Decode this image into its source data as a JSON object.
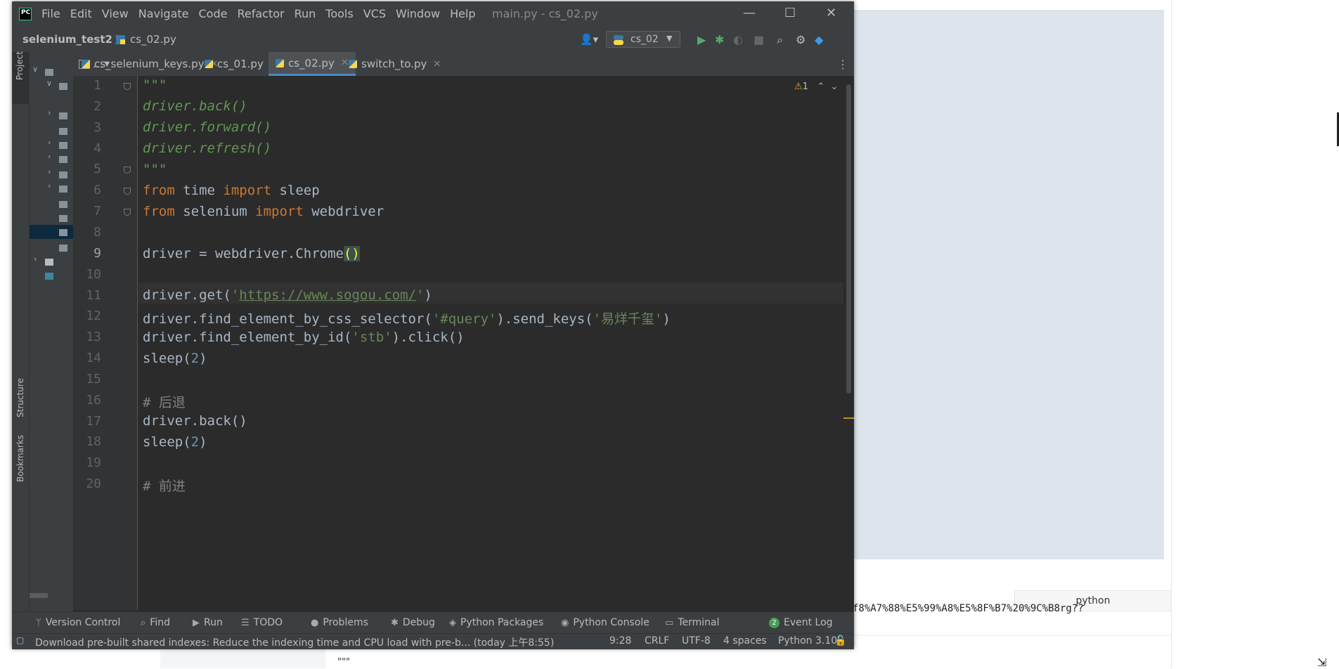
{
  "window": {
    "menu": [
      "File",
      "Edit",
      "View",
      "Navigate",
      "Code",
      "Refactor",
      "Run",
      "Tools",
      "VCS",
      "Window",
      "Help"
    ],
    "title": "main.py - cs_02.py",
    "controls": [
      "—",
      "☐",
      "✕"
    ]
  },
  "navbar": {
    "project": "selenium_test2",
    "file": "cs_02.py",
    "run_config": "cs_02"
  },
  "side_tabs": {
    "project": "Project",
    "structure": "Structure",
    "bookmarks": "Bookmarks"
  },
  "tabs": [
    {
      "label": "cs_selenium_keys.py",
      "active": false
    },
    {
      "label": "cs_01.py",
      "active": false
    },
    {
      "label": "cs_02.py",
      "active": true
    },
    {
      "label": "switch_to.py",
      "active": false
    }
  ],
  "tabs_more": "...",
  "editor": {
    "warnings": "1",
    "current_line": 9,
    "line_numbers": [
      "1",
      "2",
      "3",
      "4",
      "5",
      "6",
      "7",
      "8",
      "9",
      "10",
      "11",
      "12",
      "13",
      "14",
      "15",
      "16",
      "17",
      "18",
      "19",
      "20"
    ]
  },
  "code": {
    "l1": "\"\"\"",
    "l2": "driver.back()",
    "l3": "driver.forward()",
    "l4": "driver.refresh()",
    "l5": "\"\"\"",
    "l6_kw1": "from",
    "l6_mod": " time ",
    "l6_kw2": "import",
    "l6_name": " sleep",
    "l7_kw1": "from",
    "l7_mod": " selenium ",
    "l7_kw2": "import",
    "l7_name": " webdriver",
    "l9_pre": "driver = webdriver.Chrome",
    "l9_paren": "()",
    "l11_pre": "driver.get(",
    "l11_q1": "'",
    "l11_url": "https://www.sogou.com/",
    "l11_q2": "'",
    "l11_post": ")",
    "l12_pre": "driver.find_element_by_css_selector(",
    "l12_s1": "'#query'",
    "l12_mid": ").send_keys(",
    "l12_s2": "'易烊千玺'",
    "l12_post": ")",
    "l13_pre": "driver.find_element_by_id(",
    "l13_s": "'stb'",
    "l13_post": ").click()",
    "l14_pre": "sleep(",
    "l14_num": "2",
    "l14_post": ")",
    "l16": "# 后退",
    "l17": "driver.back()",
    "l18_pre": "sleep(",
    "l18_num": "2",
    "l18_post": ")",
    "l20": "# 前进"
  },
  "tool_windows": [
    "Version Control",
    "Find",
    "Run",
    "TODO",
    "Problems",
    "Debug",
    "Python Packages",
    "Python Console",
    "Terminal"
  ],
  "event_log": {
    "count": "2",
    "label": "Event Log"
  },
  "status": {
    "message": "Download pre-built shared indexes: Reduce the indexing time and CPU load with pre-b... (today 上午8:55)",
    "position": "9:28",
    "line_sep": "CRLF",
    "encoding": "UTF-8",
    "indent": "4 spaces",
    "interpreter": "Python 3.10"
  },
  "background": {
    "url_fragment": "f8%A7%88%E5%99%A8%E5%8F%B7%20%9C%B8rg??",
    "code_lang_tag": "python",
    "quotes": "\"\"\""
  }
}
